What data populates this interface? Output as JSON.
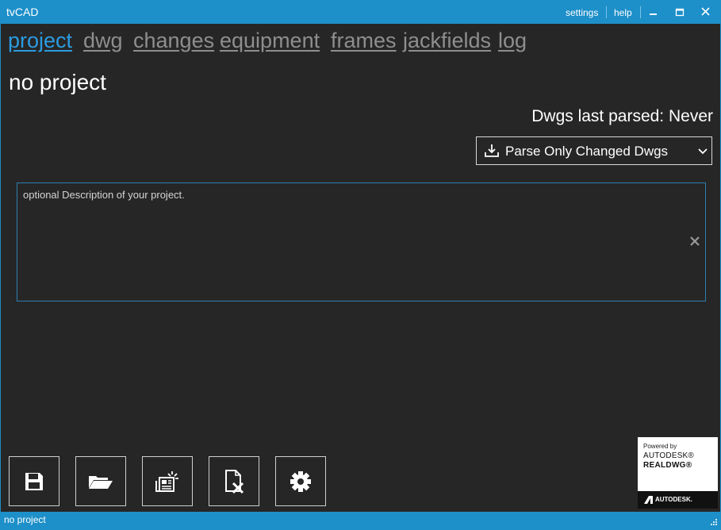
{
  "titlebar": {
    "title": "tvCAD",
    "settings_label": "settings",
    "help_label": "help"
  },
  "nav": {
    "tabs": [
      {
        "label": "project",
        "accel": "p",
        "active": true
      },
      {
        "label": "dwg",
        "accel": "d",
        "active": false
      },
      {
        "label": "changes",
        "accel": "c",
        "active": false
      },
      {
        "label": "equipment",
        "accel": "e",
        "active": false
      },
      {
        "label": "frames",
        "accel": "f",
        "active": false
      },
      {
        "label": "jackfields",
        "accel": "j",
        "active": false
      },
      {
        "label": "log",
        "accel": "l",
        "active": false
      }
    ]
  },
  "project": {
    "title": "no project",
    "dwgs_parsed_label": "Dwgs last parsed: Never"
  },
  "parse": {
    "label": "Parse Only Changed Dwgs",
    "icon": "download-tray-icon"
  },
  "description": {
    "placeholder": "optional Description of your project.",
    "clear_icon": "close-icon"
  },
  "toolbar": {
    "buttons": [
      {
        "name": "save-button",
        "icon": "floppy-disk-icon"
      },
      {
        "name": "open-button",
        "icon": "open-folder-icon"
      },
      {
        "name": "new-project-button",
        "icon": "newspaper-spark-icon"
      },
      {
        "name": "close-project-button",
        "icon": "document-x-icon"
      },
      {
        "name": "settings-button",
        "icon": "gear-icon"
      }
    ]
  },
  "logo": {
    "powered_by": "Powered by",
    "autodesk": "AUTODESK®",
    "realdwg": "REALDWG®",
    "footer": "AUTODESK."
  },
  "status": {
    "text": "no project"
  },
  "colors": {
    "accent": "#1d8fc9",
    "active_tab": "#2b9be0",
    "inactive_tab": "#8e8e8e",
    "background": "#262626"
  }
}
